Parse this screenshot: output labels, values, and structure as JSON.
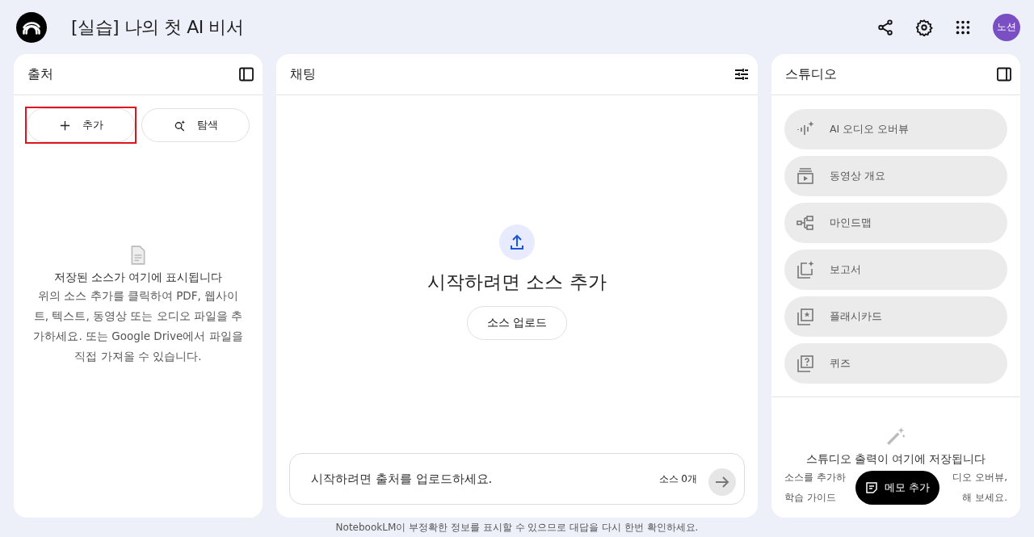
{
  "header": {
    "title": "[실습] 나의 첫 AI 비서",
    "avatar": "노션"
  },
  "sources": {
    "title": "출처",
    "buttons": [
      {
        "label": "추가",
        "kind": "add",
        "highlighted": true
      },
      {
        "label": "탐색",
        "kind": "discover",
        "highlighted": false
      }
    ],
    "empty_title": "저장된 소스가 여기에 표시됩니다",
    "empty_text": "위의 소스 추가를 클릭하여 PDF, 웹사이트, 텍스트, 동영상 또는 오디오 파일을 추가하세요. 또는 Google Drive에서 파일을 직접 가져올 수 있습니다."
  },
  "chat": {
    "title": "채팅",
    "heading": "시작하려면 소스 추가",
    "upload_button": "소스 업로드",
    "input_placeholder": "시작하려면 출처를 업로드하세요.",
    "source_count": "소스 0개"
  },
  "studio": {
    "title": "스튜디오",
    "items": [
      {
        "label": "AI 오디오 오버뷰",
        "kind": "audio"
      },
      {
        "label": "동영상 개요",
        "kind": "video"
      },
      {
        "label": "마인드맵",
        "kind": "mindmap"
      },
      {
        "label": "보고서",
        "kind": "report"
      },
      {
        "label": "플래시카드",
        "kind": "flashcard"
      },
      {
        "label": "퀴즈",
        "kind": "quiz"
      }
    ],
    "empty_title": "스튜디오 출력이 여기에 저장됩니다",
    "empty_lines": [
      {
        "left": "소스를 추가하",
        "right": "디오 오버뷰,"
      },
      {
        "left": "학습 가이드",
        "right": "해 보세요."
      }
    ],
    "memo_button": "메모 추가"
  },
  "footer": "NotebookLM이 부정확한 정보를 표시할 수 있으므로 대답을 다시 한번 확인하세요."
}
